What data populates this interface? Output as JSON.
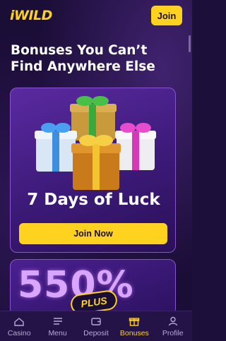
{
  "header": {
    "logo": "iWILD",
    "join_label": "Join"
  },
  "hero": {
    "title": "Bonuses You Can’t Find Anywhere Else"
  },
  "promo_card": {
    "title": "7 Days of Luck",
    "button_label": "Join Now"
  },
  "promo_card_2": {
    "headline": "550%",
    "badge": "PLUS"
  },
  "bottom_nav": {
    "items": [
      {
        "label": "Casino",
        "icon": "casino-icon"
      },
      {
        "label": "Menu",
        "icon": "menu-icon"
      },
      {
        "label": "Deposit",
        "icon": "wallet-icon"
      },
      {
        "label": "Bonuses",
        "icon": "gift-icon"
      },
      {
        "label": "Profile",
        "icon": "profile-icon"
      }
    ],
    "active": "Bonuses"
  },
  "colors": {
    "accent": "#ffd21f",
    "background": "#1a0d36",
    "card_border": "#8a52d6"
  }
}
